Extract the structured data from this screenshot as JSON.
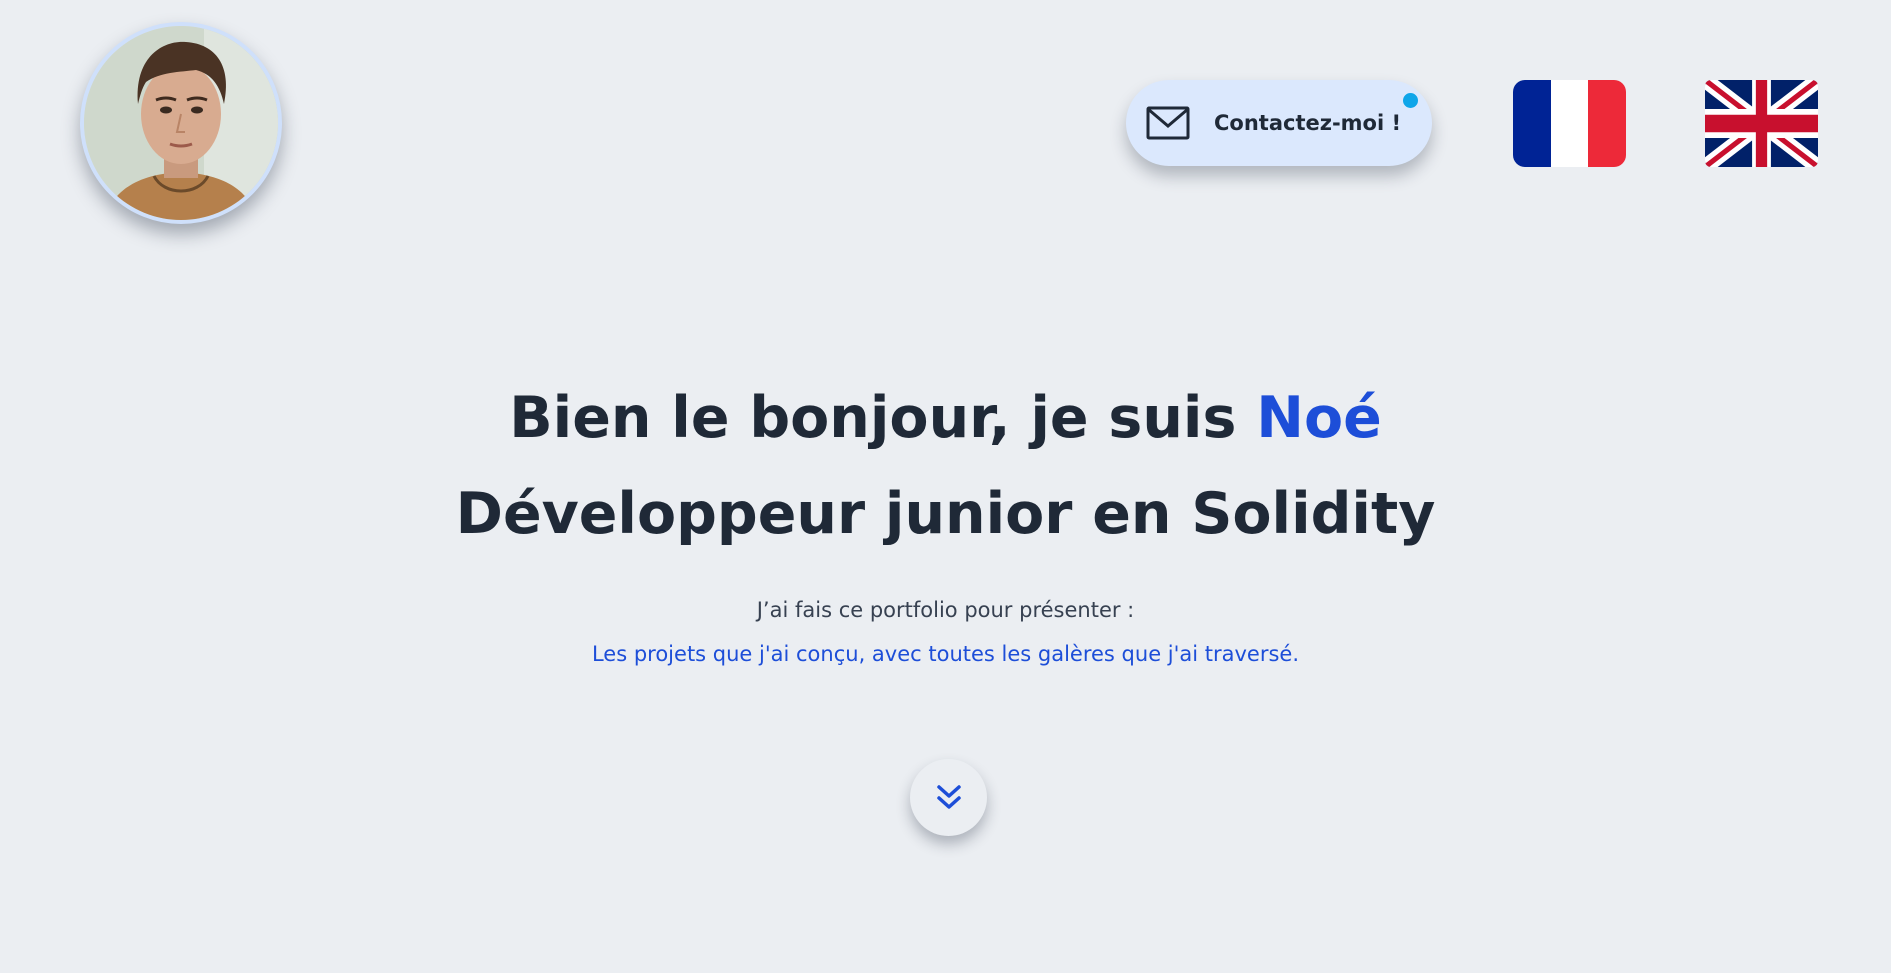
{
  "header": {
    "avatar": {
      "alt": "Noé",
      "icon": "avatar-photo"
    },
    "contact": {
      "label": "Contactez-moi !",
      "icon": "mail-icon",
      "notification_color": "#0ea5e9"
    },
    "languages": [
      {
        "code": "fr",
        "icon": "french-flag-icon"
      },
      {
        "code": "en",
        "icon": "uk-flag-icon"
      }
    ]
  },
  "hero": {
    "greeting": "Bien le bonjour, je suis ",
    "name": "Noé",
    "role": "Développeur junior en Solidity",
    "intro": "J’ai fais ce portfolio pour présenter :",
    "projects_link": "Les projets que j'ai conçu, avec toutes les galères que j'ai traversé."
  },
  "scroll": {
    "icon": "chevrons-down-icon"
  },
  "colors": {
    "background": "#ebeef2",
    "accent": "#1d4ed8",
    "text": "#1f2937",
    "contact_bg": "#dbe8fd"
  }
}
